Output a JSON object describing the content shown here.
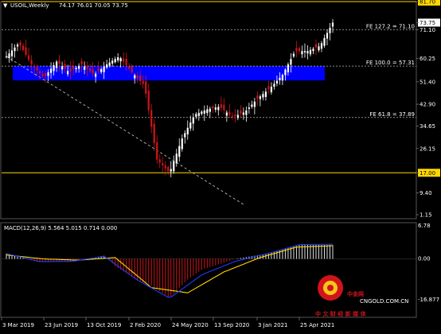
{
  "header": {
    "symbol_label": "USOIL,Weekly",
    "ohlc": "74.17 76.01 70.05 73.75"
  },
  "colors": {
    "background": "#000000",
    "bull": "#FFFFFF",
    "bear": "#D0141A",
    "zone": "#0000FF",
    "level": "#FFD700",
    "fib": "#B8B8B8",
    "macd_signal": "#FFD700",
    "macd_line": "#1E3CFF",
    "watermark": "#D0141A"
  },
  "price_axis": {
    "labels": [
      "81.70",
      "73.75",
      "71.10",
      "60.25",
      "51.40",
      "42.90",
      "34.65",
      "26.15",
      "17.00",
      "9.40",
      "1.15"
    ],
    "current": "73.75",
    "badge_levels": [
      "81.70",
      "17.00"
    ]
  },
  "fib_levels": [
    {
      "label": "FE 127.2 = 71.10",
      "value": 71.1
    },
    {
      "label": "FE 100.0 = 57.31",
      "value": 57.31
    },
    {
      "label": "FE 61.8 = 37.89",
      "value": 37.89
    }
  ],
  "horizontal_levels": [
    81.7,
    17.0
  ],
  "zone": {
    "low": 51.9,
    "high": 57.3
  },
  "trendline": {
    "from": {
      "x": "3 Mar 2019",
      "y": 61.0
    },
    "to": {
      "x": "12 Apr 2021",
      "y": 5.0
    }
  },
  "time_axis": {
    "labels": [
      "3 Mar 2019",
      "23 Jun 2019",
      "13 Oct 2019",
      "2 Feb 2020",
      "24 May 2020",
      "13 Sep 2020",
      "3 Jan 2021",
      "25 Apr 2021"
    ]
  },
  "macd": {
    "label": "MACD(12,26,9) 5.564 5.015 0.714 0.000",
    "axis_labels": [
      "6.78",
      "0.00",
      "-16.877"
    ]
  },
  "watermark": {
    "brand_cn": "中金网",
    "url": "CNGOLD.COM.CN",
    "tagline": "中 文 财 经 新 媒 体"
  },
  "chart_data": {
    "type": "candlestick",
    "title": "USOIL,Weekly",
    "ylim": [
      1.15,
      81.7
    ],
    "x_range": [
      "3 Mar 2019",
      "May 2021"
    ],
    "grid": false,
    "close_path": [
      [
        "Mar 2019",
        61
      ],
      [
        "Apr 2019",
        66
      ],
      [
        "May 2019",
        58
      ],
      [
        "Jun 2019",
        53
      ],
      [
        "Jul 2019",
        59
      ],
      [
        "Aug 2019",
        55
      ],
      [
        "Sep 2019",
        58
      ],
      [
        "Oct 2019",
        54
      ],
      [
        "Nov 2019",
        58
      ],
      [
        "Dec 2019",
        61
      ],
      [
        "Jan 2020",
        55
      ],
      [
        "Feb 2020",
        50
      ],
      [
        "Mar 2020",
        22
      ],
      [
        "Apr 2020",
        17
      ],
      [
        "May 2020",
        30
      ],
      [
        "Jun 2020",
        39
      ],
      [
        "Jul 2020",
        41
      ],
      [
        "Aug 2020",
        42
      ],
      [
        "Sep 2020",
        38
      ],
      [
        "Oct 2020",
        40
      ],
      [
        "Nov 2020",
        45
      ],
      [
        "Dec 2020",
        49
      ],
      [
        "Jan 2021",
        54
      ],
      [
        "Feb 2021",
        63
      ],
      [
        "Mar 2021",
        63
      ],
      [
        "Apr 2021",
        65
      ],
      [
        "May 2021",
        73.75
      ]
    ],
    "macd_main_path": [
      [
        "Mar 2019",
        2
      ],
      [
        "Jul 2019",
        -1
      ],
      [
        "Oct 2019",
        -1
      ],
      [
        "Jan 2020",
        1
      ],
      [
        "Mar 2020",
        -8
      ],
      [
        "Apr 2020",
        -15
      ],
      [
        "Jun 2020",
        -6
      ],
      [
        "Sep 2020",
        -1
      ],
      [
        "Dec 2020",
        2
      ],
      [
        "Feb 2021",
        5.5
      ],
      [
        "May 2021",
        5.564
      ]
    ],
    "macd_signal_path": [
      [
        "Mar 2019",
        1.5
      ],
      [
        "Jul 2019",
        0
      ],
      [
        "Oct 2019",
        -0.5
      ],
      [
        "Jan 2020",
        0.5
      ],
      [
        "Apr 2020",
        -11
      ],
      [
        "May 2020",
        -13
      ],
      [
        "Aug 2020",
        -5
      ],
      [
        "Nov 2020",
        0.5
      ],
      [
        "Feb 2021",
        4.5
      ],
      [
        "May 2021",
        5.015
      ]
    ]
  }
}
